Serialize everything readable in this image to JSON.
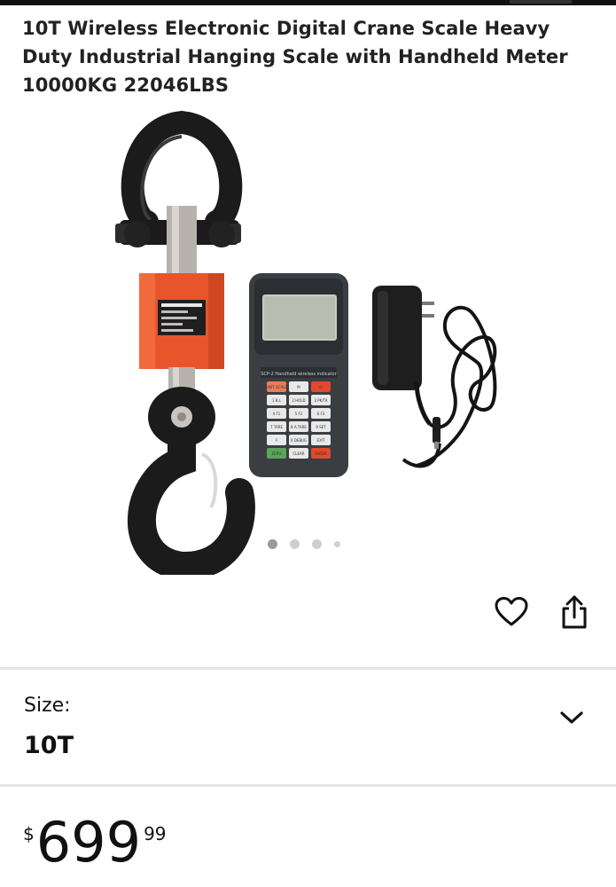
{
  "product": {
    "title": "10T Wireless Electronic Digital Crane Scale Heavy Duty Industrial Hanging Scale with Handheld Meter 10000KG 22046LBS"
  },
  "gallery": {
    "image_count": 4,
    "active_index": 0
  },
  "actions": {
    "favorite_icon": "heart-icon",
    "share_icon": "share-icon"
  },
  "size": {
    "label": "Size:",
    "value": "10T",
    "icon": "chevron-down-icon"
  },
  "price": {
    "currency": "$",
    "whole": "699",
    "fraction": "99"
  },
  "meter": {
    "model_text": "SCP-2 Handheld wireless indicator",
    "keys": [
      [
        "UNIT SCALE",
        "M",
        "⏻"
      ],
      [
        "1 B.L",
        "2 HOLD",
        "3 PK/TA"
      ],
      [
        "4 F1",
        "5 F2",
        "6 F3"
      ],
      [
        "7 TARE",
        "8 A.TARE",
        "9 SET"
      ],
      [
        "F",
        "0 DEBUG",
        "EXIT"
      ],
      [
        "ZERO",
        "CLEAR",
        "ENTER"
      ]
    ]
  },
  "colors": {
    "scale_orange": "#e8552a",
    "hook_black": "#1b1b1b",
    "meter_body": "#3a3d42",
    "key_green": "#5aa55a",
    "key_red": "#e2492e"
  }
}
